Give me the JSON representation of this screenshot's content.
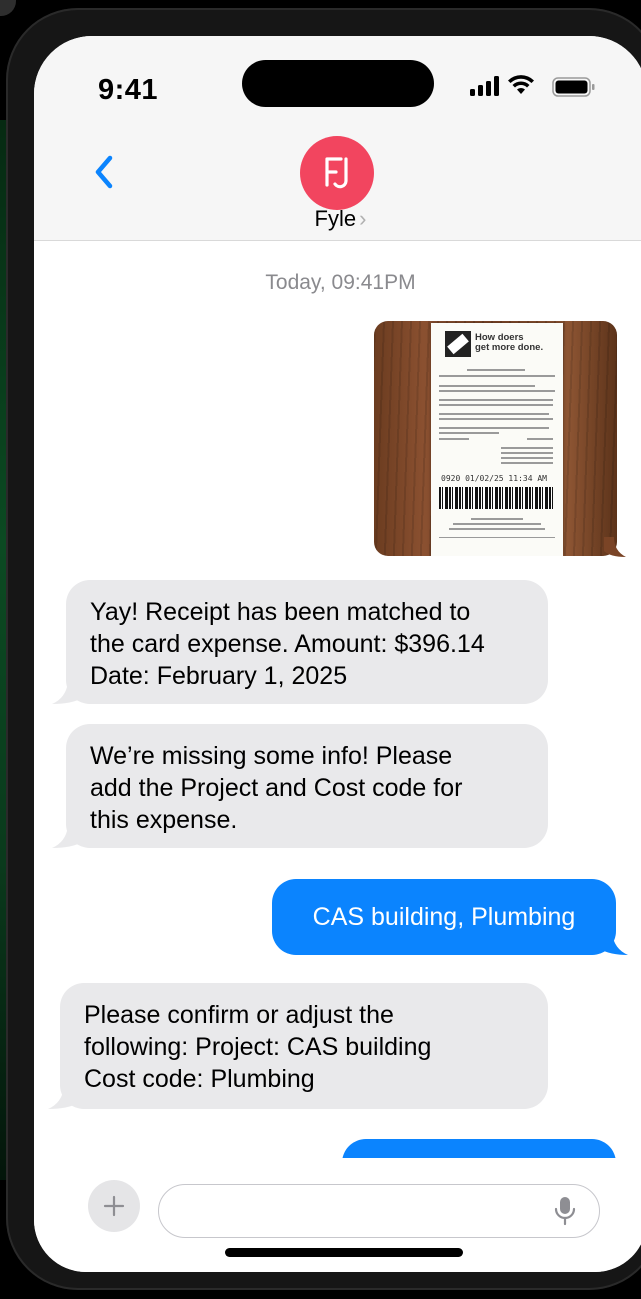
{
  "status_bar": {
    "time": "9:41"
  },
  "header": {
    "contact_name": "Fyle",
    "avatar_initials": "FJ"
  },
  "thread": {
    "timestamp": "Today, 09:41PM",
    "receipt": {
      "logo_line1": "How doers",
      "logo_line2": "get more done.",
      "code_line": "0920 01/02/25 11:34 AM"
    },
    "messages": [
      {
        "from": "contact",
        "lines": [
          "Yay! Receipt has been matched to",
          "the card expense. Amount: $396.14",
          "Date: February 1, 2025"
        ]
      },
      {
        "from": "contact",
        "lines": [
          "We’re missing some info! Please",
          "add the Project and Cost code for",
          "this expense."
        ]
      },
      {
        "from": "me",
        "lines": [
          "CAS building, Plumbing"
        ]
      },
      {
        "from": "contact",
        "lines": [
          "Please confirm or adjust the",
          "following: Project: CAS building",
          "Cost code: Plumbing"
        ]
      },
      {
        "from": "me",
        "lines": [
          ""
        ]
      }
    ]
  },
  "composer": {
    "placeholder": ""
  },
  "colors": {
    "imessage_blue": "#0b84fe",
    "incoming_gray": "#e9e9eb",
    "avatar": "#f2455f"
  }
}
